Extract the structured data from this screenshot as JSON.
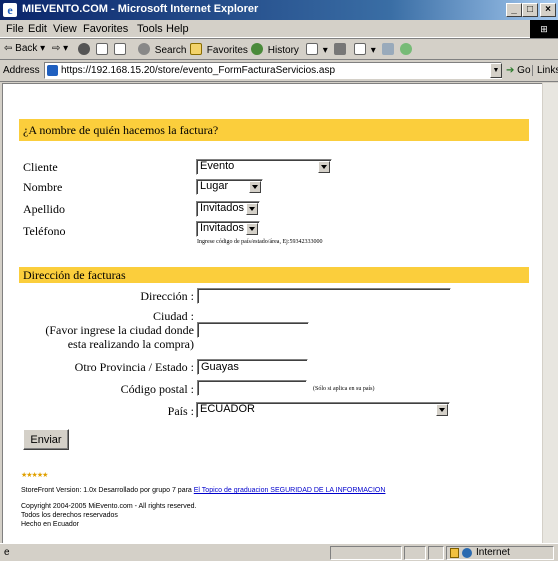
{
  "window": {
    "title": "MIEVENTO.COM - Microsoft Internet Explorer",
    "min": "_",
    "max": "□",
    "close": "×"
  },
  "menu": [
    "File",
    "Edit",
    "View",
    "Favorites",
    "Tools",
    "Help"
  ],
  "toolbar": {
    "back": "Back",
    "search": "Search",
    "favorites": "Favorites",
    "history": "History"
  },
  "address": {
    "label": "Address",
    "url": "https://192.168.15.20/store/evento_FormFacturaServicios.asp",
    "go": "Go",
    "links": "Links"
  },
  "form": {
    "heading": "¿A nombre de quién hacemos la factura?",
    "fields": {
      "cliente": {
        "label": "Cliente",
        "value": "Evento"
      },
      "nombre": {
        "label": "Nombre",
        "value": "Lugar"
      },
      "apellido": {
        "label": "Apellido",
        "value": "Invitados"
      },
      "telefono": {
        "label": "Teléfono",
        "value": "Invitados",
        "hint": "Ingrese código de país/estado/área, Ej:59342333000"
      }
    },
    "address_heading": "Dirección de facturas",
    "direccion": {
      "label": "Dirección :",
      "value": ""
    },
    "ciudad": {
      "label1": "Ciudad :",
      "label2": "(Favor ingrese la ciudad donde",
      "label3": "esta realizando la compra)",
      "value": ""
    },
    "provincia": {
      "label": "Otro Provincia / Estado :",
      "value": "Guayas"
    },
    "postal": {
      "label": "Código postal :",
      "value": "",
      "hint": "(Sólo si aplica en su país)"
    },
    "pais": {
      "label": "País :",
      "value": "ECUADOR"
    },
    "submit": "Enviar"
  },
  "footer": {
    "stars": "★★★★★",
    "version_prefix": "StoreFront Version: 1.0x Desarrollado por grupo 7 para ",
    "version_link": "El Topico de graduacion SEGURIDAD DE LA INFORMACION",
    "copyright": "Copyright 2004-2005 MiEvento.com - All rights reserved.",
    "rights": "Todos los derechos reservados",
    "made": "Hecho en Ecuador"
  },
  "status": {
    "zone": "Internet"
  },
  "colors": {
    "band": "#fbce3c",
    "titlebar": "#0a246a",
    "link": "#0000cc"
  }
}
